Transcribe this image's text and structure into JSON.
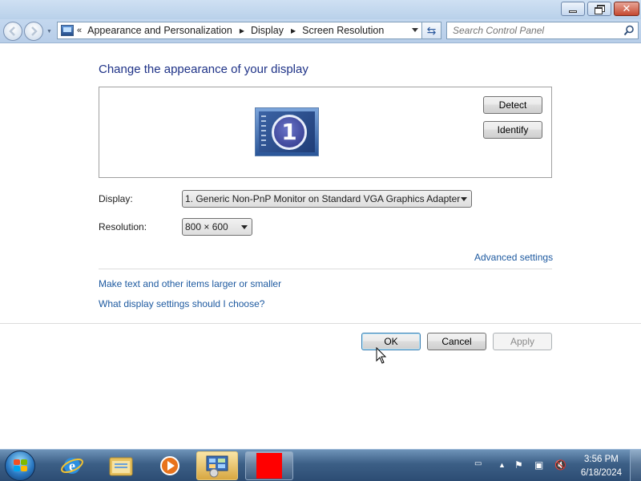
{
  "window": {
    "breadcrumb_prefix": "«",
    "breadcrumbs": [
      "Appearance and Personalization",
      "Display",
      "Screen Resolution"
    ],
    "search_placeholder": "Search Control Panel"
  },
  "main": {
    "heading": "Change the appearance of your display",
    "monitor_number": "1",
    "detect_label": "Detect",
    "identify_label": "Identify",
    "display_label": "Display:",
    "display_value": "1. Generic Non-PnP Monitor on Standard VGA Graphics Adapter",
    "resolution_label": "Resolution:",
    "resolution_value": "800 × 600",
    "advanced_link": "Advanced settings",
    "link_text_size": "Make text and other items larger or smaller",
    "link_help": "What display settings should I choose?",
    "ok_label": "OK",
    "cancel_label": "Cancel",
    "apply_label": "Apply"
  },
  "taskbar": {
    "time": "3:56 PM",
    "date": "6/18/2024",
    "apps": [
      "internet-explorer",
      "windows-explorer",
      "media-player",
      "control-panel",
      "red-square-app"
    ]
  },
  "colors": {
    "heading": "#1e3287",
    "link": "#1e5aa0",
    "taskbar": "#3c5f86"
  }
}
